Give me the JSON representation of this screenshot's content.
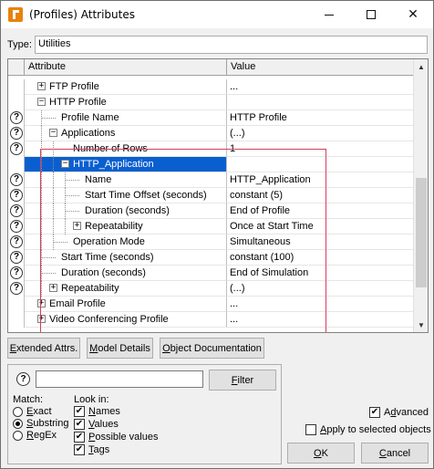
{
  "window": {
    "title": "(Profiles) Attributes"
  },
  "type_row": {
    "label": "Type:",
    "value": "Utilities"
  },
  "grid": {
    "headers": {
      "attribute": "Attribute",
      "value": "Value"
    },
    "rows": [
      {
        "label": "FTP Profile",
        "value": "...",
        "help": false,
        "expander": "+"
      },
      {
        "label": "HTTP Profile",
        "value": "",
        "help": false,
        "expander": "−"
      },
      {
        "label": "Profile Name",
        "value": "HTTP Profile",
        "help": true,
        "expander": ""
      },
      {
        "label": "Applications",
        "value": "(...)",
        "help": true,
        "expander": "−"
      },
      {
        "label": "Number of Rows",
        "value": "1",
        "help": true,
        "expander": ""
      },
      {
        "label": "HTTP_Application",
        "value": "",
        "help": false,
        "expander": "−",
        "selected": true
      },
      {
        "label": "Name",
        "value": "HTTP_Application",
        "help": true,
        "expander": ""
      },
      {
        "label": "Start Time Offset (seconds)",
        "value": "constant (5)",
        "help": true,
        "expander": ""
      },
      {
        "label": "Duration (seconds)",
        "value": "End of Profile",
        "help": true,
        "expander": ""
      },
      {
        "label": "Repeatability",
        "value": "Once at Start Time",
        "help": true,
        "expander": "+"
      },
      {
        "label": "Operation Mode",
        "value": "Simultaneous",
        "help": true,
        "expander": ""
      },
      {
        "label": "Start Time (seconds)",
        "value": "constant (100)",
        "help": true,
        "expander": ""
      },
      {
        "label": "Duration (seconds)",
        "value": "End of Simulation",
        "help": true,
        "expander": ""
      },
      {
        "label": "Repeatability",
        "value": "(...)",
        "help": true,
        "expander": "+"
      },
      {
        "label": "Email Profile",
        "value": "...",
        "help": false,
        "expander": "+"
      },
      {
        "label": "Video Conferencing Profile",
        "value": "...",
        "help": false,
        "expander": "+"
      }
    ]
  },
  "buttons": {
    "extended_pre": "",
    "extended_u": "E",
    "extended_post": "xtended Attrs.",
    "model_pre": "",
    "model_u": "M",
    "model_post": "odel Details",
    "objdoc_pre": "",
    "objdoc_u": "O",
    "objdoc_post": "bject Documentation"
  },
  "find": {
    "input_value": "",
    "filter_pre": "",
    "filter_u": "F",
    "filter_post": "ilter",
    "match_label": "Match:",
    "lookin_label": "Look in:",
    "match_options": [
      {
        "pre": "",
        "u": "E",
        "post": "xact",
        "selected": false
      },
      {
        "pre": "",
        "u": "S",
        "post": "ubstring",
        "selected": true
      },
      {
        "pre": "",
        "u": "R",
        "post": "egEx",
        "selected": false
      }
    ],
    "lookin_options": [
      {
        "pre": "",
        "u": "N",
        "post": "ames",
        "checked": true
      },
      {
        "pre": "",
        "u": "V",
        "post": "alues",
        "checked": true
      },
      {
        "pre": "",
        "u": "P",
        "post": "ossible values",
        "checked": true
      },
      {
        "pre": "",
        "u": "T",
        "post": "ags",
        "checked": true
      }
    ]
  },
  "options": {
    "advanced_pre": "A",
    "advanced_u": "d",
    "advanced_post": "vanced",
    "advanced_checked": true,
    "apply_pre": "",
    "apply_u": "A",
    "apply_post": "pply to selected objects",
    "apply_checked": false
  },
  "dialog": {
    "ok_pre": "",
    "ok_u": "O",
    "ok_post": "K",
    "cancel_pre": "",
    "cancel_u": "C",
    "cancel_post": "ancel"
  },
  "icons": {
    "help": "help-question-icon",
    "expand": "tree-expander-icon",
    "check_glyph": "✔",
    "help_glyph": "?"
  },
  "colors": {
    "selection": "#0a5fd0",
    "highlight_box": "#d23f5f"
  }
}
